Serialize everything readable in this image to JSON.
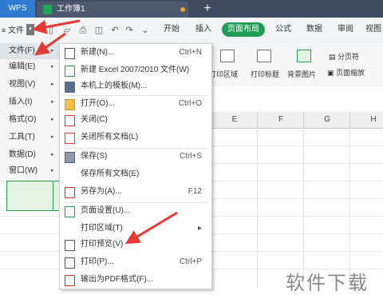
{
  "tabs": {
    "app_label": "WPS",
    "doc_label": "工作簿1",
    "new_tab": "+"
  },
  "ribbon": {
    "file_label": "文件",
    "file_drop": "▾",
    "tabs": [
      "开始",
      "插入",
      "页面布局",
      "公式",
      "数据",
      "审阅",
      "视图"
    ],
    "active_tab": "页面布局",
    "accent": "#1f9d55"
  },
  "toolbar": {
    "print_area": "打印区域",
    "print_titles": "打印标题",
    "background": "背景图片",
    "page_break": "分页符",
    "page_zoom": "页面缩放"
  },
  "columns": [
    "E",
    "F",
    "G",
    "H"
  ],
  "main_menu": [
    {
      "label": "文件(F)"
    },
    {
      "label": "编辑(E)"
    },
    {
      "label": "视图(V)"
    },
    {
      "label": "插入(I)"
    },
    {
      "label": "格式(O)"
    },
    {
      "label": "工具(T)"
    },
    {
      "label": "数据(D)"
    },
    {
      "label": "窗口(W)"
    }
  ],
  "file_submenu": [
    {
      "label": "新建(N)...",
      "shortcut": "Ctrl+N",
      "icon": "new-doc-icon"
    },
    {
      "label": "新建 Excel 2007/2010 文件(W)",
      "shortcut": "",
      "icon": "new-excel-icon"
    },
    {
      "label": "本机上的模板(M)...",
      "shortcut": "",
      "icon": "template-icon"
    },
    {
      "label": "打开(O)...",
      "shortcut": "Ctrl+O",
      "icon": "open-folder-icon"
    },
    {
      "label": "关闭(C)",
      "shortcut": "",
      "icon": "close-doc-icon"
    },
    {
      "label": "关闭所有文档(L)",
      "shortcut": "",
      "icon": "close-all-icon"
    },
    {
      "label": "保存(S)",
      "shortcut": "Ctrl+S",
      "icon": "save-icon"
    },
    {
      "label": "保存所有文档(E)",
      "shortcut": "",
      "icon": ""
    },
    {
      "label": "另存为(A)...",
      "shortcut": "F12",
      "icon": "save-as-icon"
    },
    {
      "label": "页面设置(U)...",
      "shortcut": "",
      "icon": "page-setup-icon"
    },
    {
      "label": "打印区域(T)",
      "shortcut": "▸",
      "icon": ""
    },
    {
      "label": "打印预览(V)",
      "shortcut": "",
      "icon": "print-preview-icon"
    },
    {
      "label": "打印(P)...",
      "shortcut": "Ctrl+P",
      "icon": "print-icon"
    },
    {
      "label": "输出为PDF格式(F)...",
      "shortcut": "",
      "icon": "pdf-icon"
    }
  ],
  "watermark": "软件下载",
  "annotation_color": "#e53935"
}
